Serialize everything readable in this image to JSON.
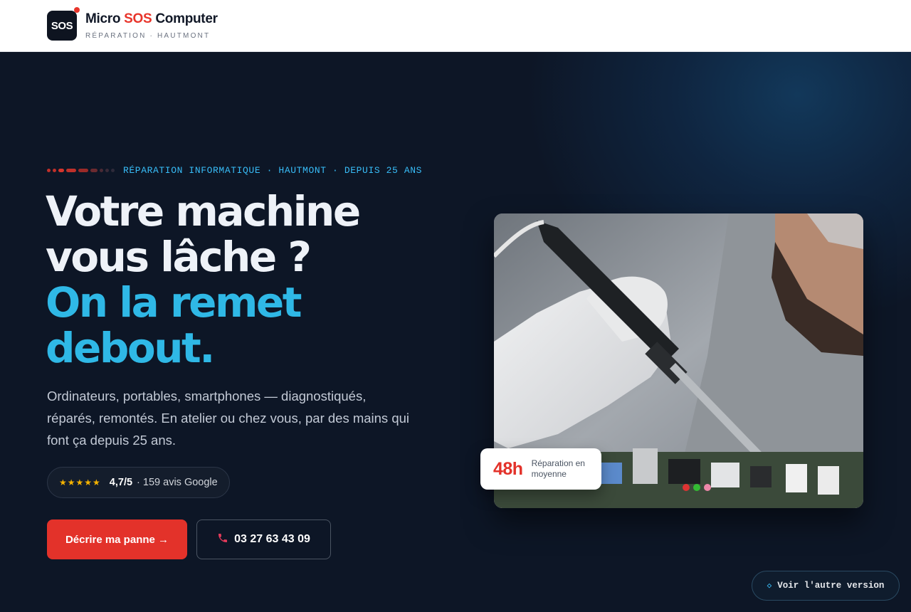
{
  "header": {
    "logo_text": "SOS",
    "brand_prefix": "Micro ",
    "brand_highlight": "SOS",
    "brand_suffix": " Computer",
    "tagline": "RÉPARATION · HAUTMONT"
  },
  "hero": {
    "eyebrow": "RÉPARATION INFORMATIQUE · HAUTMONT · DEPUIS 25 ANS",
    "headline_line1": "Votre machine",
    "headline_line2": "vous lâche ?",
    "headline_accent1": "On la remet",
    "headline_accent2": "debout.",
    "lead": "Ordinateurs, portables, smartphones — diagnostiqués, réparés, remontés. En atelier ou chez vous, par des mains qui font ça depuis 25 ans.",
    "rating": {
      "stars": "★★★★★",
      "score": "4,7/5",
      "reviews": "· 159 avis Google"
    },
    "cta_primary": "Décrire ma panne →",
    "cta_phone": "03 27 63 43 09",
    "stat": {
      "value": "48h",
      "label": "Réparation en moyenne"
    }
  },
  "alt_version": "Voir l'autre version",
  "icons": {
    "phone": "phone-icon",
    "diamond": "diamond-icon",
    "star": "star-icon"
  },
  "colors": {
    "accent_red": "#e3322a",
    "accent_cyan": "#2fb8e6",
    "background": "#0d1626"
  }
}
